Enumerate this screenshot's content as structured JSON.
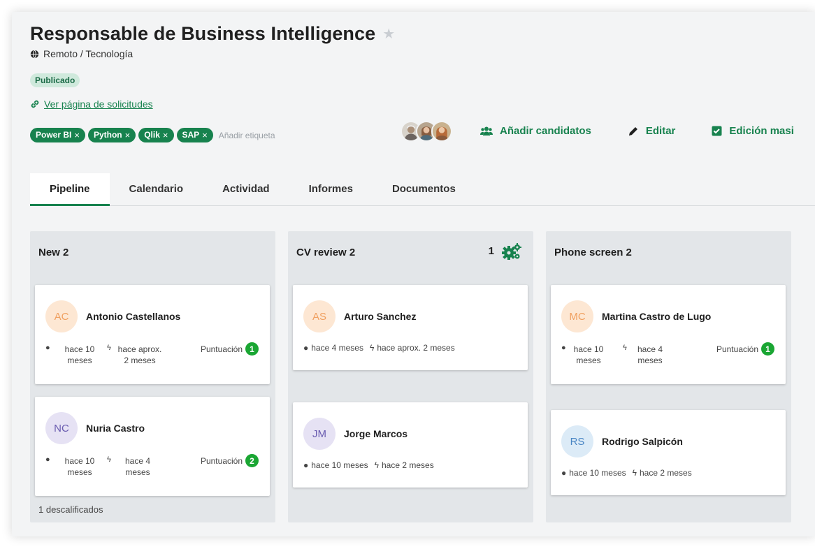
{
  "job": {
    "title": "Responsable de Business Intelligence",
    "location": "Remoto / Tecnología",
    "status": "Publicado",
    "applications_link": "Ver página de solicitudes"
  },
  "tags": [
    "Power BI",
    "Python",
    "Qlik",
    "SAP"
  ],
  "tag_remove": "×",
  "add_tag": "Añadir etiqueta",
  "actions": {
    "add_candidates": "Añadir candidatos",
    "edit": "Editar",
    "bulk_edit": "Edición masi"
  },
  "tabs": [
    "Pipeline",
    "Calendario",
    "Actividad",
    "Informes",
    "Documentos"
  ],
  "columns": [
    {
      "title": "New 2",
      "cards": [
        {
          "initials": "AC",
          "name": "Antonio Castellanos",
          "time1": "hace 10 meses",
          "time2": "hace aprox. 2 meses",
          "score_label": "Puntuación",
          "score": "1"
        },
        {
          "initials": "NC",
          "name": "Nuria Castro",
          "time1": "hace 10 meses",
          "time2": "hace 4 meses",
          "score_label": "Puntuación",
          "score": "2"
        }
      ],
      "footer": "1 descalificados"
    },
    {
      "title": "CV review 2",
      "count": "1",
      "cards": [
        {
          "initials": "AS",
          "name": "Arturo Sanchez",
          "time1": "hace 4 meses",
          "time2": "hace aprox. 2 meses"
        },
        {
          "initials": "JM",
          "name": "Jorge Marcos",
          "time1": "hace 10 meses",
          "time2": "hace 2 meses"
        }
      ]
    },
    {
      "title": "Phone screen 2",
      "cards": [
        {
          "initials": "MC",
          "name": "Martina Castro de Lugo",
          "time1": "hace 10 meses",
          "time2": "hace 4 meses",
          "score_label": "Puntuación",
          "score": "1"
        },
        {
          "initials": "RS",
          "name": "Rodrigo Salpicón",
          "time1": "hace 10 meses",
          "time2": "hace 2 meses"
        }
      ]
    }
  ],
  "colors": {
    "brand": "#17824e",
    "score": "#1aa633",
    "avatar_orange_bg": "#fde7d3",
    "avatar_purple_bg": "#e6e2f4",
    "avatar_blue_bg": "#dcebf7"
  }
}
